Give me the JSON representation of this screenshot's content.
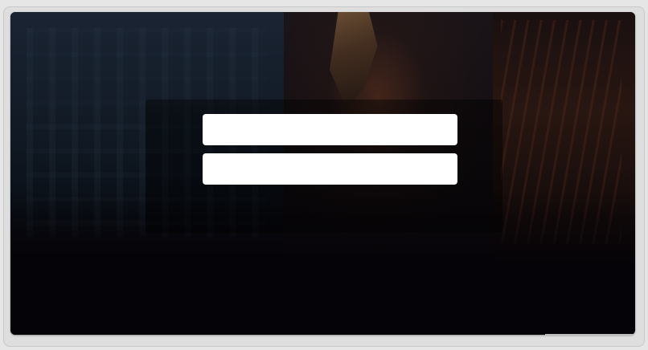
{
  "window": {
    "frame_color": "#dedede",
    "content_background": "#050307"
  },
  "login_form": {
    "username_field": {
      "value": "",
      "placeholder": ""
    },
    "password_field": {
      "value": "",
      "placeholder": ""
    }
  },
  "colors": {
    "field_background": "#ffffff",
    "panel_overlay": "rgba(0,0,0,0.42)"
  }
}
